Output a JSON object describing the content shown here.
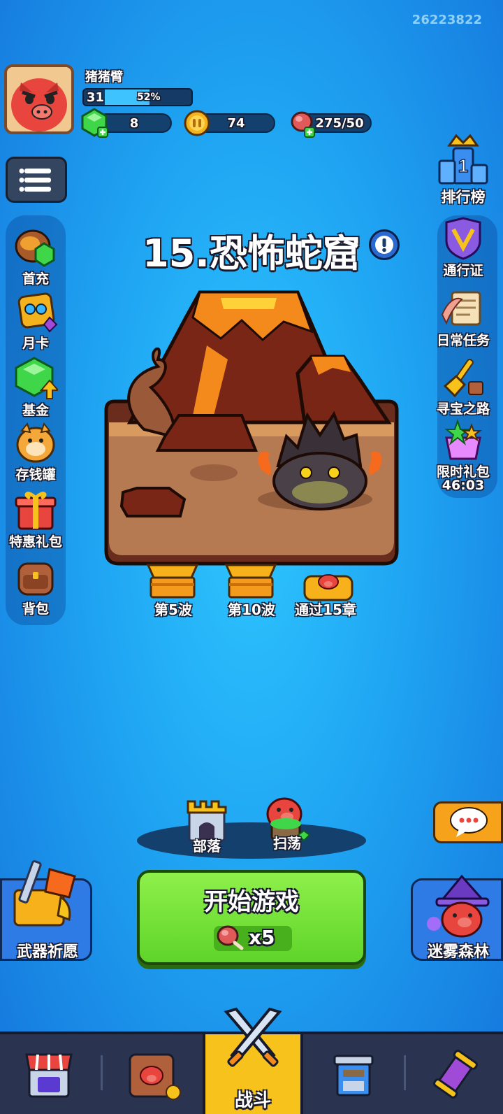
{
  "user_id": "26223822",
  "player": {
    "name": "猪猪臂",
    "level": "31",
    "exp_percent_text": "52%",
    "exp_fraction": 0.52
  },
  "resources": {
    "gems": "8",
    "coins": "74",
    "stamina": "275/50"
  },
  "left_menu": [
    {
      "label": "首充",
      "icon": "first-recharge-icon"
    },
    {
      "label": "月卡",
      "icon": "monthly-card-icon"
    },
    {
      "label": "基金",
      "icon": "fund-gem-icon"
    },
    {
      "label": "存钱罐",
      "icon": "piggy-bank-icon"
    },
    {
      "label": "特惠礼包",
      "icon": "gift-box-icon"
    },
    {
      "label": "背包",
      "icon": "backpack-icon"
    }
  ],
  "right_menu": [
    {
      "label": "排行榜",
      "icon": "leaderboard-crown-icon"
    },
    {
      "label": "通行证",
      "icon": "pass-badge-icon"
    },
    {
      "label": "日常任务",
      "icon": "daily-quest-scroll-icon"
    },
    {
      "label": "寻宝之路",
      "icon": "treasure-shovel-icon"
    },
    {
      "label": "限时礼包",
      "icon": "limited-gift-icon",
      "timer": "46:03"
    }
  ],
  "stage": {
    "title": "15.恐怖蛇窟"
  },
  "rewards": [
    {
      "label": "第5波"
    },
    {
      "label": "第10波"
    },
    {
      "label": "通过15章"
    }
  ],
  "actions": {
    "tribe": "部落",
    "sweep": "扫荡",
    "start_game": "开始游戏",
    "start_cost": "x5",
    "weapon_wish": "武器祈愿",
    "misty_forest": "迷雾森林"
  },
  "bottom_nav": {
    "battle": "战斗"
  },
  "colors": {
    "start_button": "#6fe03a",
    "nav_active": "#f7c21b",
    "background": "#1fa4f2"
  }
}
